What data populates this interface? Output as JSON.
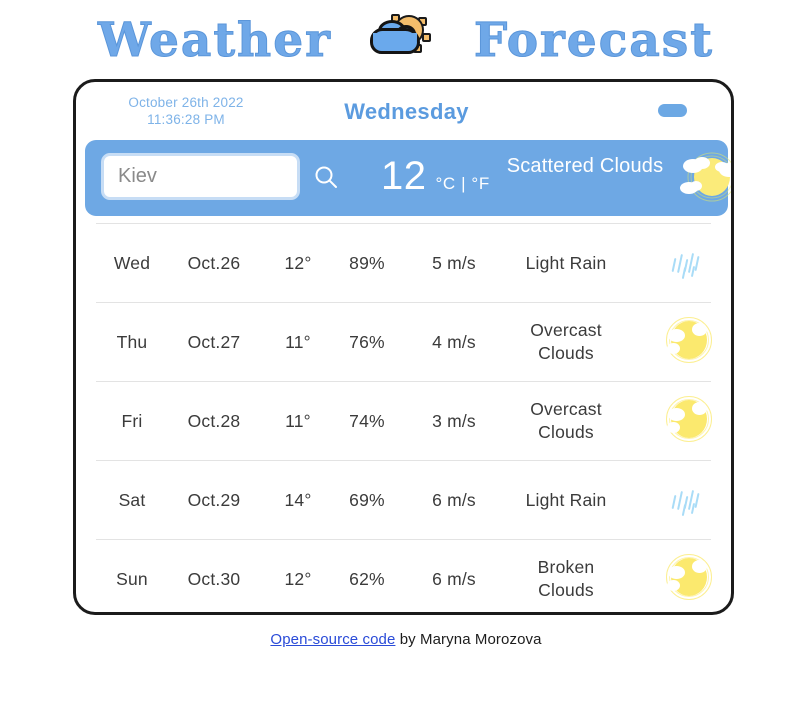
{
  "page": {
    "title_left": "Weather",
    "title_right": "Forecast",
    "title_icon": "sun-behind-cloud-icon"
  },
  "header": {
    "date": "October 26th 2022",
    "time": "11:36:28 PM",
    "day_name": "Wednesday",
    "toggle": "unit-toggle",
    "toggle_color": "#6ca8e4"
  },
  "search": {
    "value": "",
    "placeholder": "Kiev",
    "icon": "search-icon"
  },
  "current": {
    "temperature": "12",
    "units": "°C | °F",
    "condition": "Scattered Clouds",
    "icon": "sun-behind-scattered-clouds-icon",
    "band_color": "#6ea8e4"
  },
  "forecast": {
    "rows": [
      {
        "day": "Wed",
        "date": "Oct.26",
        "temp": "12°",
        "humidity": "89%",
        "wind": "5 m/s",
        "desc_line1": "Light Rain",
        "desc_line2": "",
        "icon": "rain-icon"
      },
      {
        "day": "Thu",
        "date": "Oct.27",
        "temp": "11°",
        "humidity": "76%",
        "wind": "4 m/s",
        "desc_line1": "Overcast",
        "desc_line2": "Clouds",
        "icon": "overcast-clouds-icon"
      },
      {
        "day": "Fri",
        "date": "Oct.28",
        "temp": "11°",
        "humidity": "74%",
        "wind": "3 m/s",
        "desc_line1": "Overcast",
        "desc_line2": "Clouds",
        "icon": "overcast-clouds-icon"
      },
      {
        "day": "Sat",
        "date": "Oct.29",
        "temp": "14°",
        "humidity": "69%",
        "wind": "6 m/s",
        "desc_line1": "Light Rain",
        "desc_line2": "",
        "icon": "rain-icon"
      },
      {
        "day": "Sun",
        "date": "Oct.30",
        "temp": "12°",
        "humidity": "62%",
        "wind": "6 m/s",
        "desc_line1": "Broken",
        "desc_line2": "Clouds",
        "icon": "broken-clouds-icon"
      }
    ]
  },
  "footer": {
    "link_text": "Open-source code",
    "rest_text": " by Maryna Morozova",
    "link_color": "#2a4bd8"
  }
}
